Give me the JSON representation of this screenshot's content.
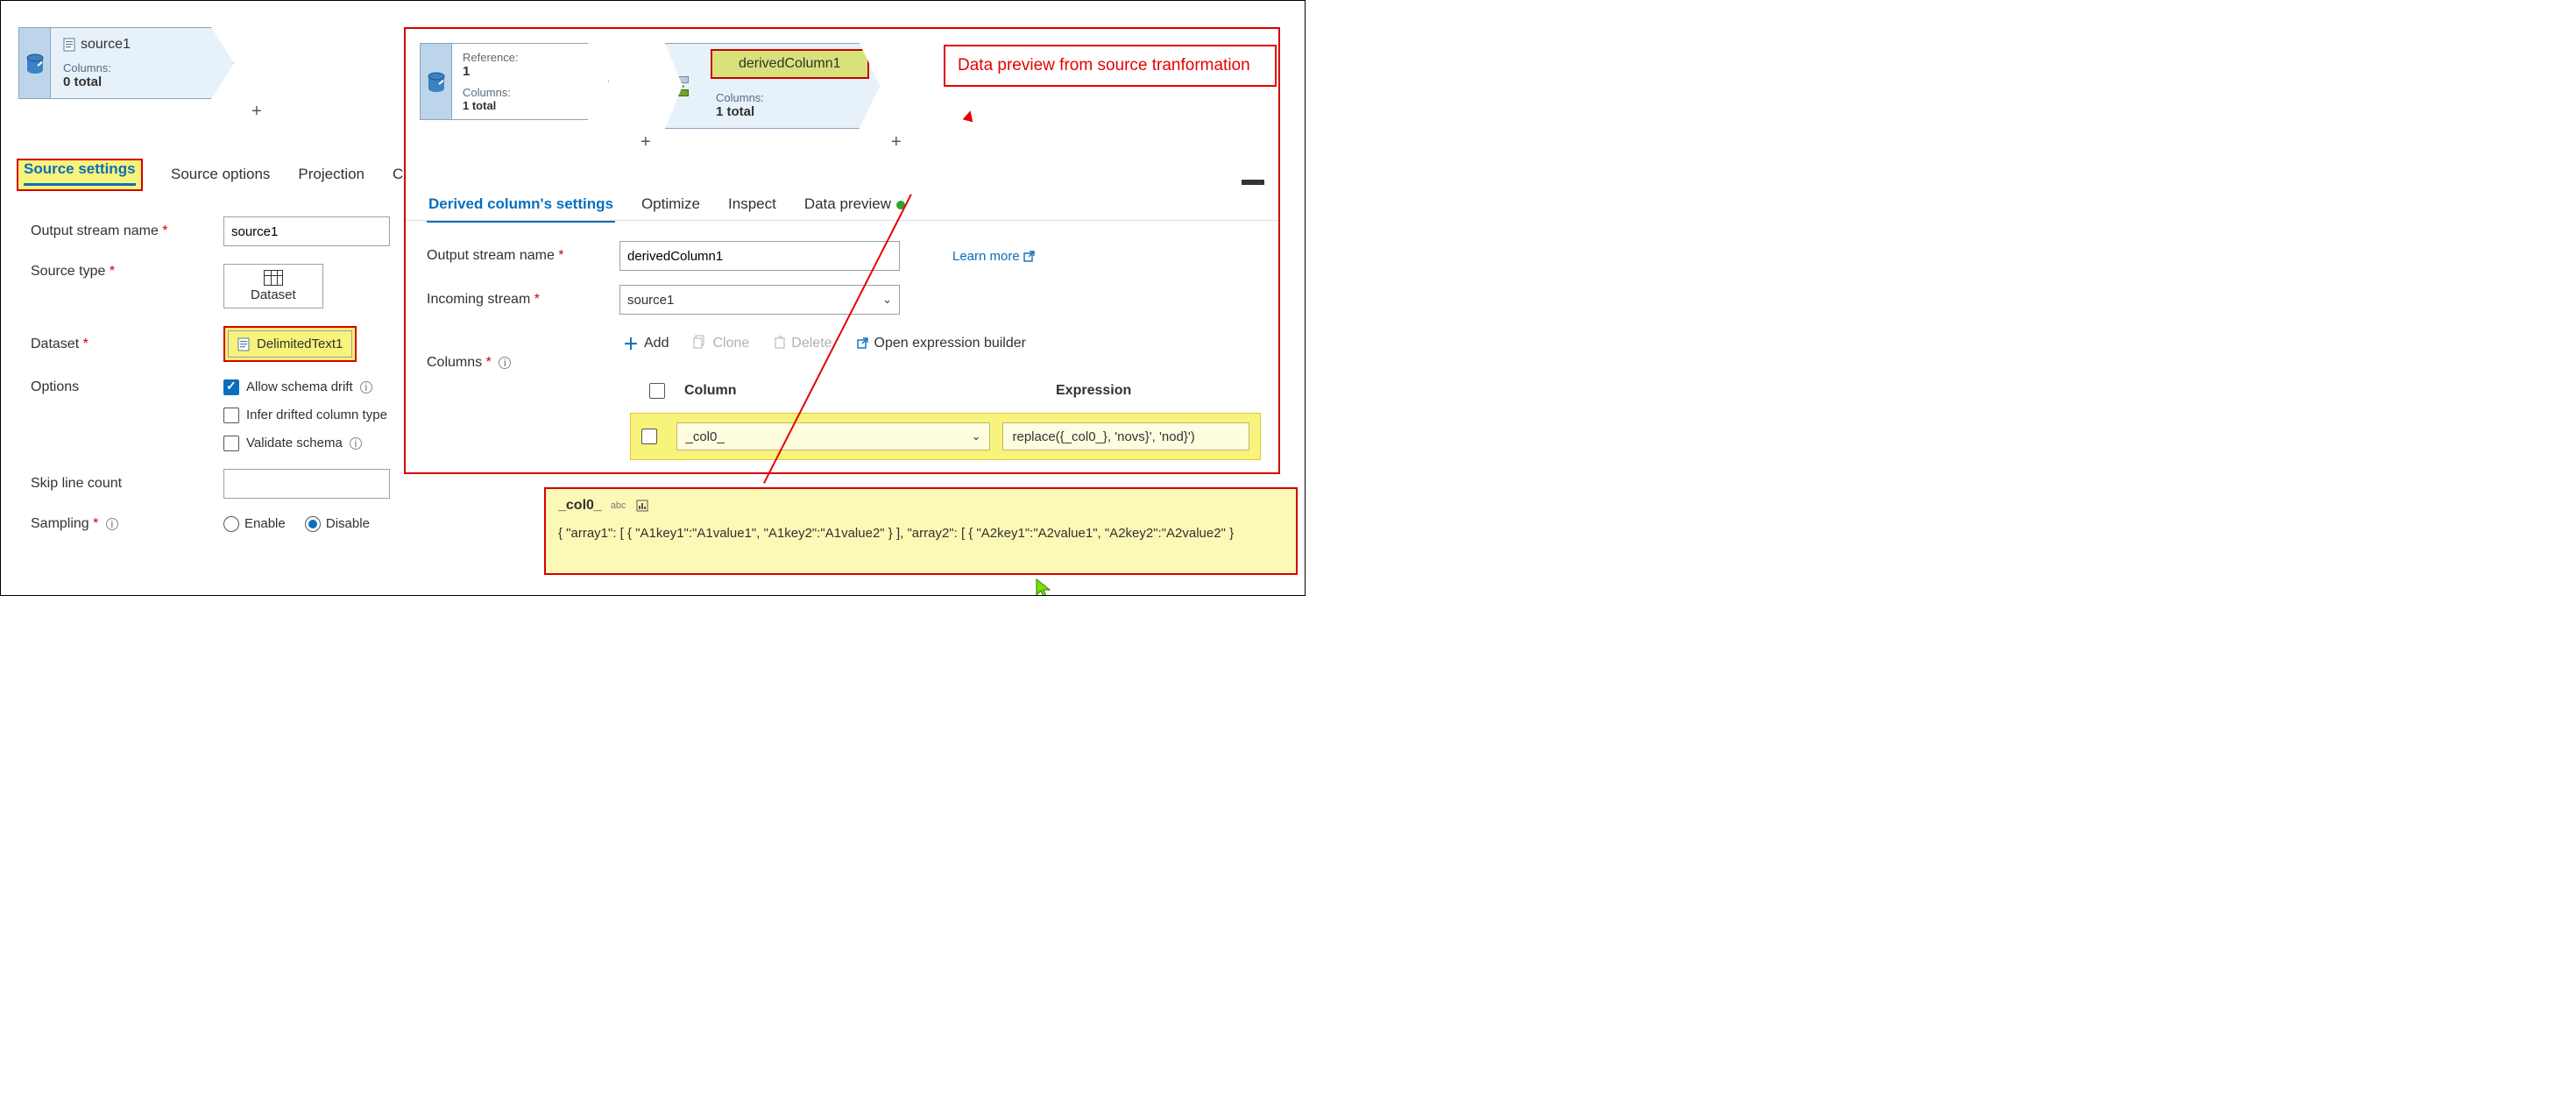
{
  "source_node": {
    "title": "source1",
    "cols_label": "Columns:",
    "cols_value": "0 total"
  },
  "ref_node": {
    "ref_label": "Reference:",
    "ref_value": "1",
    "cols_label": "Columns:",
    "cols_value": "1 total"
  },
  "derived_node": {
    "title": "derivedColumn1",
    "cols_label": "Columns:",
    "cols_value": "1 total"
  },
  "annotation": "Data preview from source tranformation",
  "left_tabs": {
    "source_settings": "Source settings",
    "source_options": "Source options",
    "projection": "Projection"
  },
  "left_form": {
    "output_stream_label": "Output stream name",
    "output_stream_value": "source1",
    "source_type_label": "Source type",
    "source_type_value": "Dataset",
    "dataset_label": "Dataset",
    "dataset_value": "DelimitedText1",
    "options_label": "Options",
    "allow_drift": "Allow schema drift",
    "infer_types": "Infer drifted column type",
    "validate_schema": "Validate schema",
    "skip_line_label": "Skip line count",
    "skip_line_value": "",
    "sampling_label": "Sampling",
    "enable": "Enable",
    "disable": "Disable"
  },
  "right_tabs": {
    "derived": "Derived column's settings",
    "optimize": "Optimize",
    "inspect": "Inspect",
    "preview": "Data preview"
  },
  "right_form": {
    "output_stream_label": "Output stream name",
    "output_stream_value": "derivedColumn1",
    "learn_more": "Learn more",
    "incoming_label": "Incoming stream",
    "incoming_value": "source1",
    "columns_label": "Columns",
    "add": "Add",
    "clone": "Clone",
    "delete": "Delete",
    "open_builder": "Open expression builder",
    "col_header_column": "Column",
    "col_header_expression": "Expression",
    "col_value": "_col0_",
    "expr_value": "replace({_col0_}, 'novs}', 'nod}')"
  },
  "preview": {
    "col": "_col0_",
    "type": "abc",
    "text": "{ \"array1\": [ { \"A1key1\":\"A1value1\", \"A1key2\":\"A1value2\" } ], \"array2\": [ { \"A2key1\":\"A2value1\", \"A2key2\":\"A2value2\" }"
  }
}
